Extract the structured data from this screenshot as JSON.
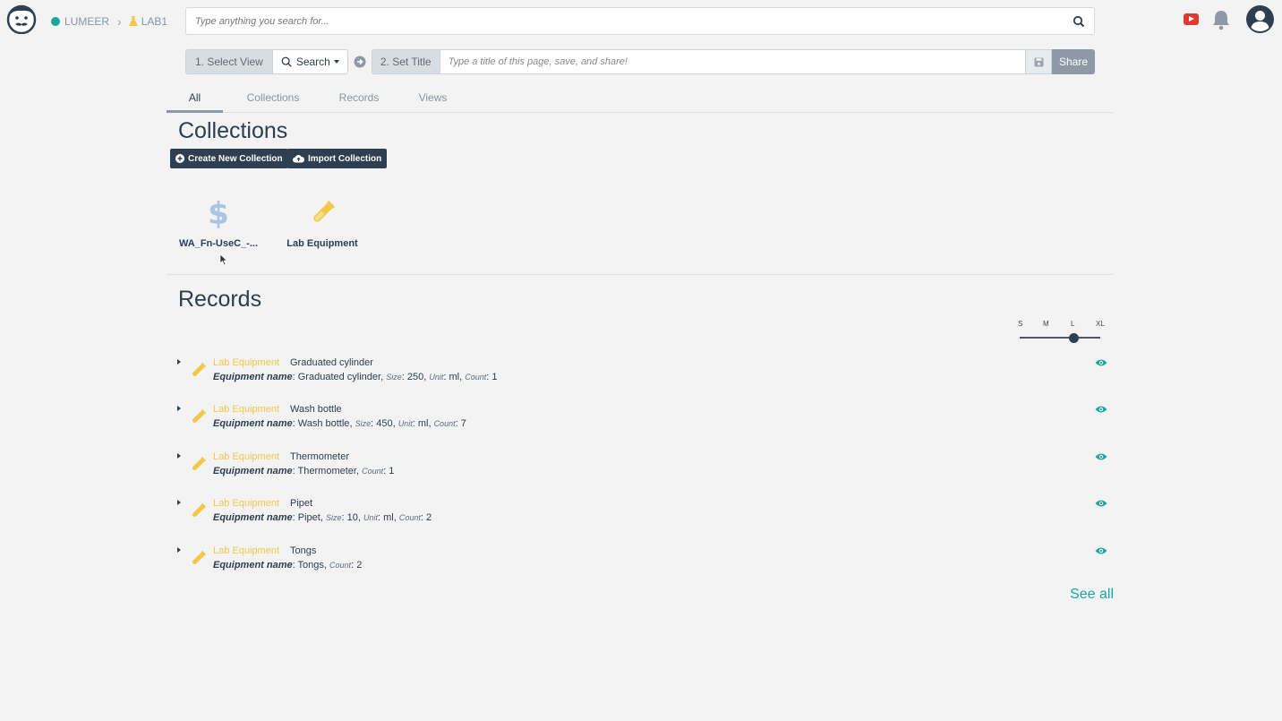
{
  "breadcrumb": {
    "org": "LUMEER",
    "project": "LAB1"
  },
  "search": {
    "placeholder": "Type anything you search for..."
  },
  "toolbar": {
    "select_view": "1. Select View",
    "search_label": "Search",
    "set_title": "2. Set Title",
    "title_placeholder": "Type a title of this page, save, and share!",
    "share": "Share"
  },
  "tabs": [
    "All",
    "Collections",
    "Records",
    "Views"
  ],
  "collections": {
    "heading": "Collections",
    "create_button": "Create New Collection",
    "import_button": "Import Collection",
    "items": [
      {
        "name": "WA_Fn-UseC_-...",
        "icon": "dollar-icon",
        "color": "#a9c4e4"
      },
      {
        "name": "Lab Equipment",
        "icon": "flask-icon",
        "color": "#f3c74a"
      }
    ]
  },
  "records": {
    "heading": "Records",
    "size_labels": [
      "S",
      "M",
      "L",
      "XL"
    ],
    "size_selected": "L",
    "items": [
      {
        "collection": "Lab Equipment",
        "title": "Graduated cylinder",
        "name_label": "Equipment name",
        "name": "Graduated cylinder",
        "attrs": [
          [
            "Size",
            "250"
          ],
          [
            "Unit",
            "ml"
          ],
          [
            "Count",
            "1"
          ]
        ]
      },
      {
        "collection": "Lab Equipment",
        "title": "Wash bottle",
        "name_label": "Equipment name",
        "name": "Wash bottle",
        "attrs": [
          [
            "Size",
            "450"
          ],
          [
            "Unit",
            "ml"
          ],
          [
            "Count",
            "7"
          ]
        ]
      },
      {
        "collection": "Lab Equipment",
        "title": "Thermometer",
        "name_label": "Equipment name",
        "name": "Thermometer",
        "attrs": [
          [
            "Count",
            "1"
          ]
        ]
      },
      {
        "collection": "Lab Equipment",
        "title": "Pipet",
        "name_label": "Equipment name",
        "name": "Pipet",
        "attrs": [
          [
            "Size",
            "10"
          ],
          [
            "Unit",
            "ml"
          ],
          [
            "Count",
            "2"
          ]
        ]
      },
      {
        "collection": "Lab Equipment",
        "title": "Tongs",
        "name_label": "Equipment name",
        "name": "Tongs",
        "attrs": [
          [
            "Count",
            "2"
          ]
        ]
      }
    ],
    "see_all": "See all"
  },
  "colors": {
    "accent": "#1aa89c",
    "dark": "#2e3f52",
    "flask": "#f3c74a",
    "youtube": "#e03a2f"
  }
}
